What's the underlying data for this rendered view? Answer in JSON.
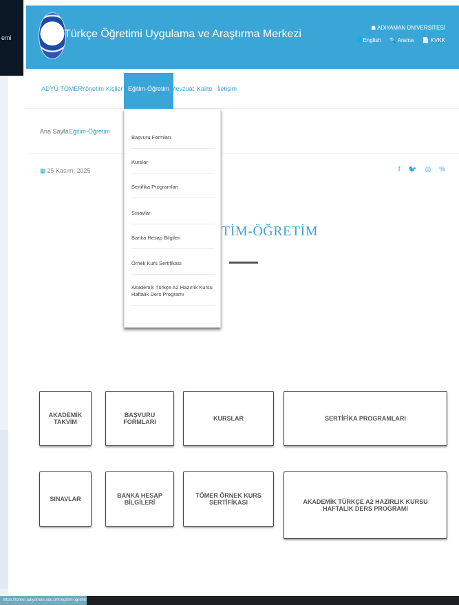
{
  "overlay": {
    "text": "emi"
  },
  "header": {
    "site_title": "Türkçe Öğretimi Uygulama ve Araştırma Merkezi",
    "university": "☗ ADIYAMAN ÜNİVERSİTESİ",
    "links": [
      "🌐English",
      "🔍 Arama",
      "📄 KVKK"
    ]
  },
  "nav": {
    "items": [
      "ADYÜ TÖMER",
      "Yönetim",
      "Kişiler",
      "Eğitim-Öğretim",
      "Mevzuat",
      "Kalite",
      "İletişim"
    ]
  },
  "breadcrumb": {
    "home": "Ana Sayfa",
    "sep": "/",
    "current": "Eğitim-Öğretim"
  },
  "date": "25 Kasım, 2025",
  "social": [
    "f",
    "🐦",
    "◎",
    "%"
  ],
  "heading": "TİM-ÖĞRETİM",
  "dropdown": {
    "items": [
      "Başvuru Formları",
      "Kurslar",
      "Sertifika Programları",
      "Sınavlar",
      "Banka Hesap Bilgileri",
      "Örnek Kurs Sertifikası",
      "Akademik Türkçe A2 Hazırlık Kursu Haftalık Ders Programı"
    ]
  },
  "cards": [
    "AKADEMİK TAKVİM",
    "BAŞVURU FORMLARI",
    "KURSLAR",
    "SERTİFİKA PROGRAMLARI",
    "SINAVLAR",
    "BANKA HESAP BİLGİLERİ",
    "TÖMER ÖRNEK KURS SERTİFİKASI",
    "AKADEMİK TÜRKÇE A2 HAZIRLIK KURSU HAFTALIK DERS PROGRAMI"
  ],
  "status_url": "https://tomer.adiyaman.edu.tr/tr/egitim-ogretim",
  "colors": {
    "brand": "#3aa6d8"
  }
}
